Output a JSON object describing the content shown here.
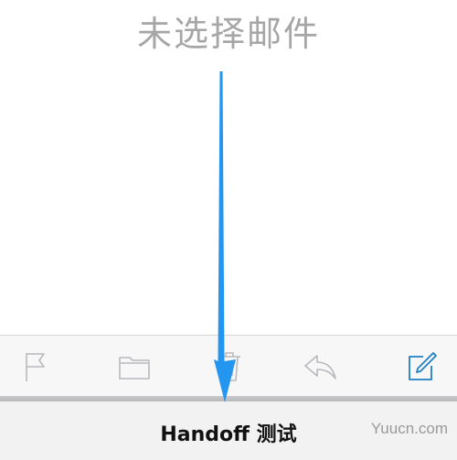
{
  "content": {
    "empty_message": "未选择邮件"
  },
  "toolbar": {
    "icons": [
      "flag-icon",
      "folder-icon",
      "trash-icon",
      "reply-icon",
      "compose-icon"
    ],
    "icon_color": "#b9b9bd",
    "accent_color": "#1f7fc2"
  },
  "handoff": {
    "label": "Handoff 测试"
  },
  "watermark": {
    "text": "Yuucn.com"
  },
  "annotation": {
    "arrow_color": "#2596ef"
  }
}
